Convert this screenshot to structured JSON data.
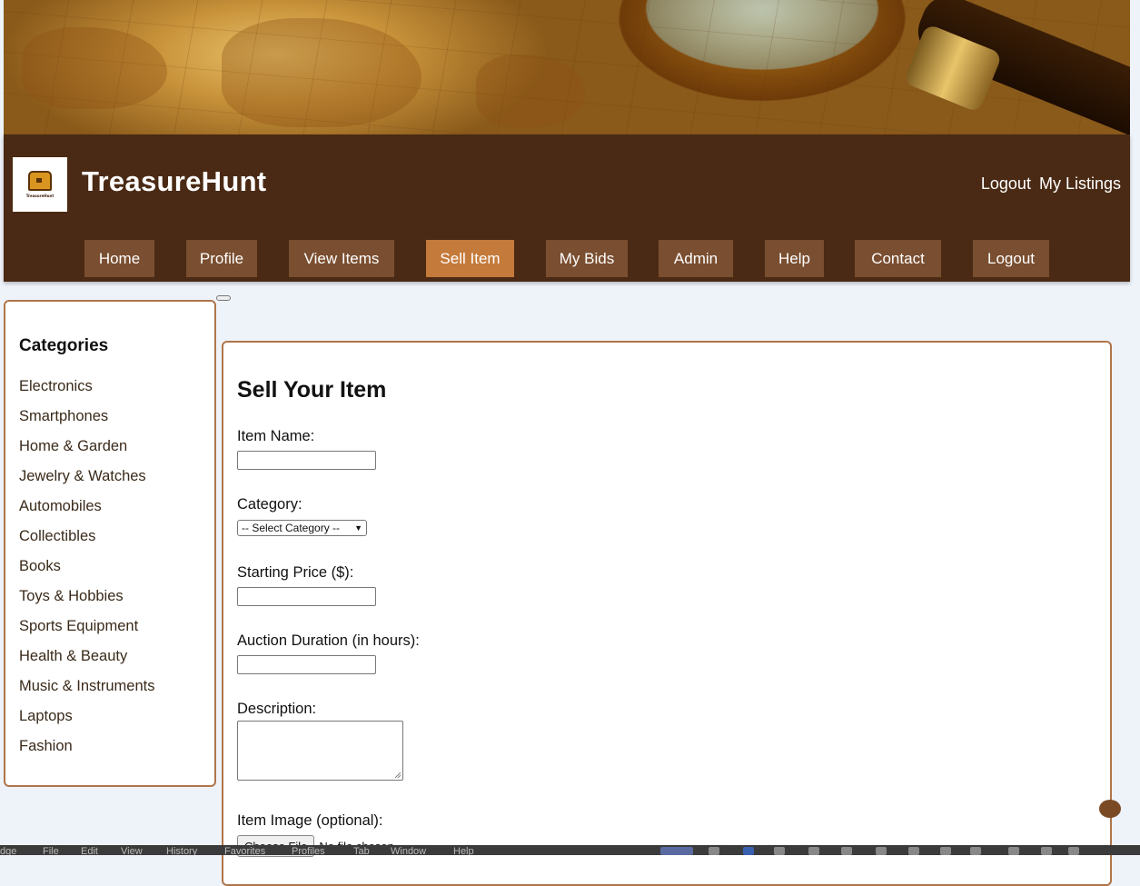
{
  "site": {
    "title": "TreasureHunt",
    "logo_text": "TreasureHunt"
  },
  "top_links": [
    "Logout",
    "My Listings"
  ],
  "nav": [
    "Home",
    "Profile",
    "View Items",
    "Sell Item",
    "My Bids",
    "Admin",
    "Help",
    "Contact",
    "Logout"
  ],
  "nav_active": "Sell Item",
  "sidebar": {
    "heading": "Categories",
    "items": [
      "Electronics",
      "Smartphones",
      "Home & Garden",
      "Jewelry & Watches",
      "Automobiles",
      "Collectibles",
      "Books",
      "Toys & Hobbies",
      "Sports Equipment",
      "Health & Beauty",
      "Music & Instruments",
      "Laptops",
      "Fashion"
    ]
  },
  "form": {
    "heading": "Sell Your Item",
    "item_name_label": "Item Name:",
    "item_name_value": "",
    "category_label": "Category:",
    "category_selected": "-- Select Category --",
    "price_label": "Starting Price ($):",
    "price_value": "",
    "duration_label": "Auction Duration (in hours):",
    "duration_value": "",
    "description_label": "Description:",
    "description_value": "",
    "image_label": "Item Image (optional):",
    "file_button": "Choose File",
    "file_status": "No file chosen"
  },
  "menubar": [
    "dge",
    "File",
    "Edit",
    "View",
    "History",
    "Favorites",
    "Profiles",
    "Tab",
    "Window",
    "Help"
  ],
  "colors": {
    "header": "#4a2a14",
    "nav_button": "#7a4e30",
    "nav_active": "#c47a3a",
    "border": "#b0754a",
    "page_bg": "#eef3fa"
  }
}
